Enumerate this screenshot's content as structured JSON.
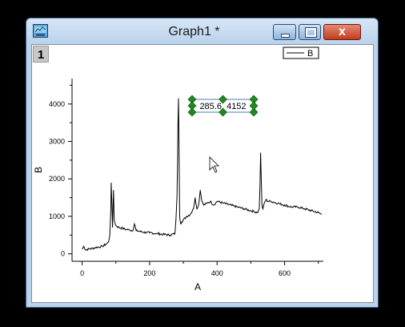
{
  "window": {
    "title": "Graph1 *",
    "close_label": "x"
  },
  "layer": {
    "label": "1"
  },
  "annotation": {
    "text": "285.6, 4152"
  },
  "chart_data": {
    "type": "line",
    "xlabel": "A",
    "ylabel": "B",
    "xlim": [
      -30,
      715
    ],
    "ylim": [
      -200,
      4680
    ],
    "xticks": [
      0,
      200,
      400,
      600
    ],
    "yticks": [
      0,
      1000,
      2000,
      3000,
      4000
    ],
    "legend": {
      "entries": [
        "B"
      ],
      "position": "top-right"
    },
    "series": [
      {
        "name": "B",
        "x": [
          0,
          5,
          10,
          20,
          30,
          40,
          50,
          60,
          70,
          78,
          82,
          85,
          86,
          88,
          90,
          93,
          95,
          100,
          110,
          120,
          130,
          140,
          150,
          155,
          160,
          170,
          180,
          200,
          220,
          240,
          260,
          275,
          278,
          281,
          283,
          284,
          285.6,
          287,
          289,
          292,
          295,
          300,
          310,
          320,
          330,
          335,
          340,
          345,
          350,
          355,
          360,
          370,
          380,
          390,
          400,
          420,
          440,
          460,
          480,
          500,
          510,
          520,
          525,
          527,
          529,
          531,
          533,
          536,
          540,
          545,
          550,
          560,
          580,
          600,
          620,
          640,
          660,
          680,
          700,
          710
        ],
        "y": [
          120,
          200,
          100,
          130,
          140,
          170,
          180,
          200,
          250,
          310,
          500,
          1200,
          1900,
          1400,
          700,
          1700,
          900,
          750,
          700,
          680,
          650,
          640,
          620,
          800,
          620,
          600,
          580,
          560,
          540,
          520,
          500,
          540,
          900,
          1500,
          2500,
          3400,
          4152,
          3000,
          1000,
          800,
          850,
          900,
          1000,
          1050,
          1200,
          1500,
          1200,
          1300,
          1700,
          1400,
          1300,
          1350,
          1400,
          1300,
          1400,
          1350,
          1300,
          1250,
          1200,
          1150,
          1130,
          1100,
          1200,
          1800,
          2700,
          2000,
          1300,
          1200,
          1350,
          1450,
          1400,
          1400,
          1350,
          1300,
          1250,
          1250,
          1200,
          1150,
          1100,
          1050
        ]
      }
    ]
  }
}
